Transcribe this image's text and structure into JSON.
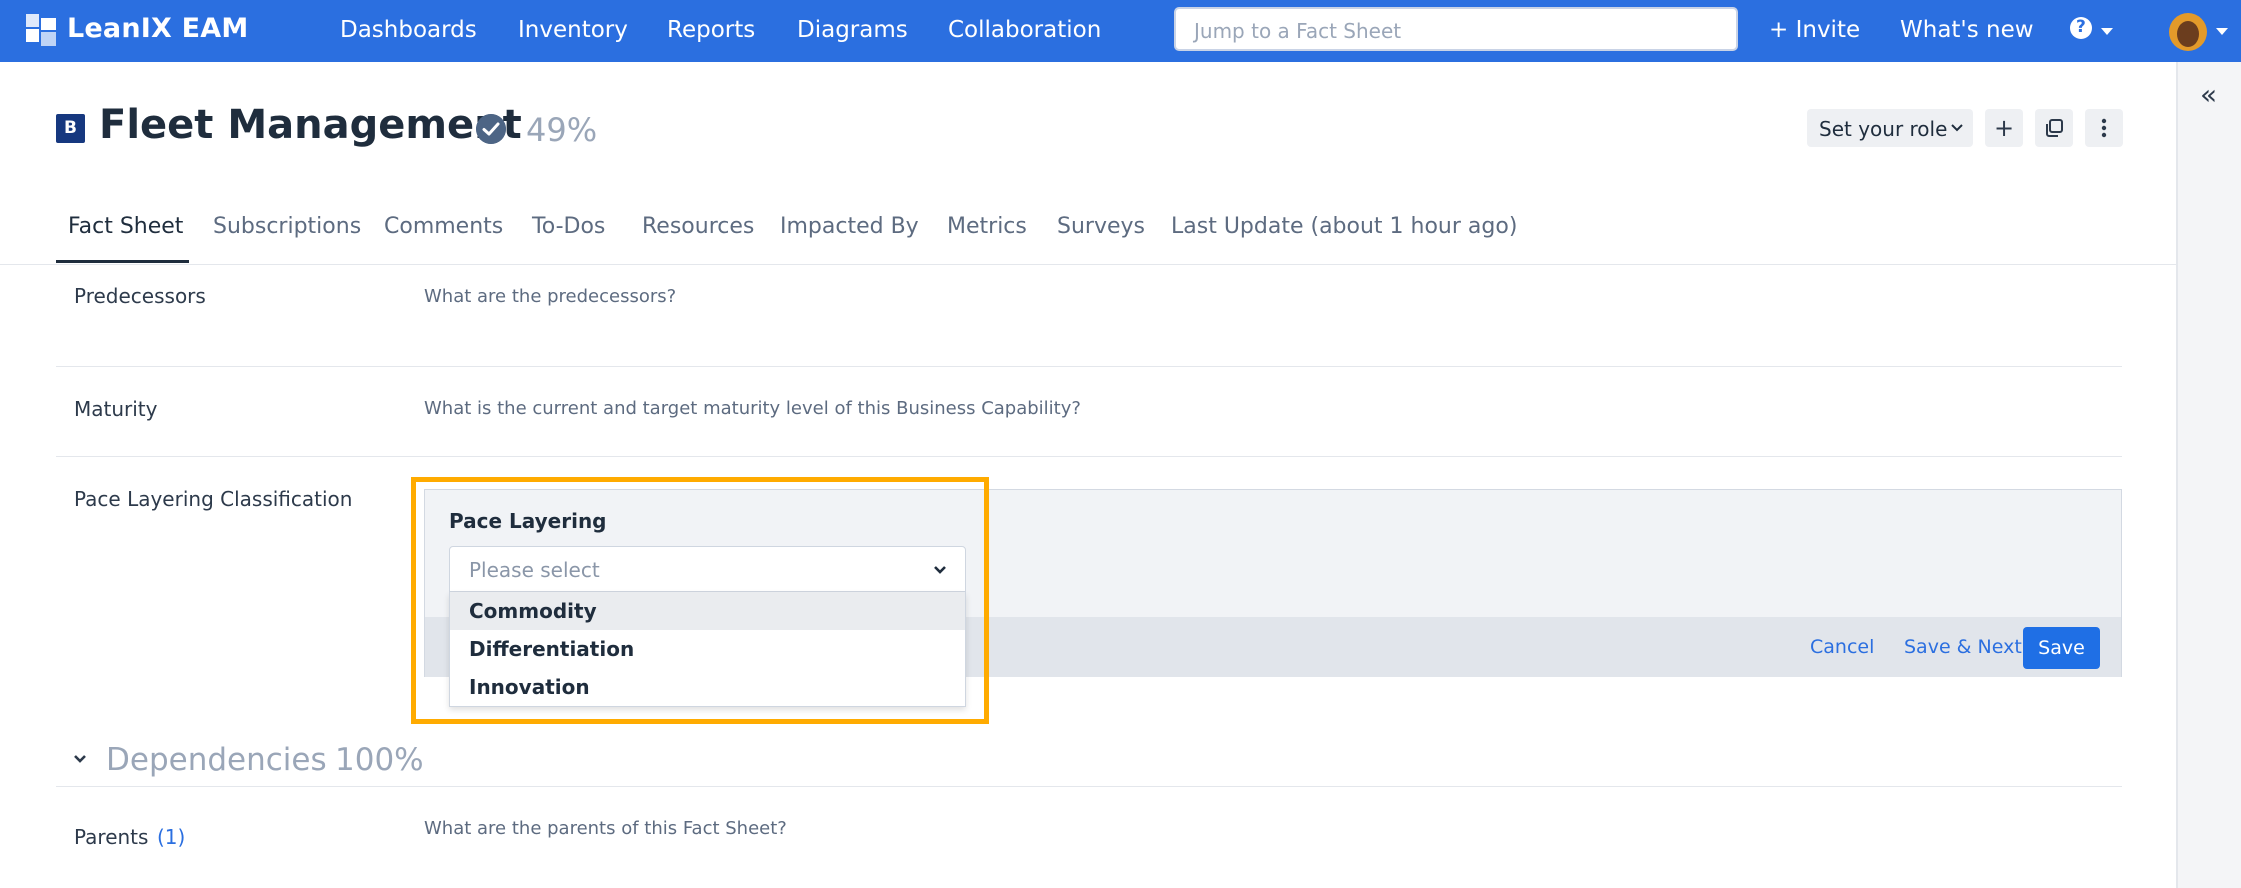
{
  "topbar": {
    "brand": "LeanIX EAM",
    "nav": [
      "Dashboards",
      "Inventory",
      "Reports",
      "Diagrams",
      "Collaboration"
    ],
    "search_placeholder": "Jump to a Fact Sheet",
    "invite": "+ Invite",
    "whats_new": "What's new",
    "help": "?",
    "colors": {
      "bar": "#2b6fe0"
    }
  },
  "header": {
    "badge": "B",
    "title": "Fleet Management",
    "completion": "49%",
    "role_button": "Set your role",
    "add_icon": "+",
    "copy_icon": "copy-icon",
    "more_icon": "more-vertical-icon"
  },
  "tabs": [
    "Fact Sheet",
    "Subscriptions",
    "Comments",
    "To-Dos",
    "Resources",
    "Impacted By",
    "Metrics",
    "Surveys",
    "Last Update (about 1 hour ago)"
  ],
  "rows": {
    "predecessors": {
      "label": "Predecessors",
      "question": "What are the predecessors?"
    },
    "maturity": {
      "label": "Maturity",
      "question": "What is the current and target maturity level of this Business Capability?"
    },
    "pace": {
      "label": "Pace Layering Classification"
    }
  },
  "editor": {
    "field_label": "Pace Layering",
    "placeholder": "Please select",
    "options": [
      "Commodity",
      "Differentiation",
      "Innovation"
    ],
    "cancel": "Cancel",
    "save_next": "Save & Next",
    "save": "Save",
    "highlight_color": "#ffab00"
  },
  "dependencies": {
    "title": "Dependencies",
    "completion": "100%",
    "parents_label": "Parents",
    "parents_count": "(1)",
    "parents_question": "What are the parents of this Fact Sheet?"
  }
}
